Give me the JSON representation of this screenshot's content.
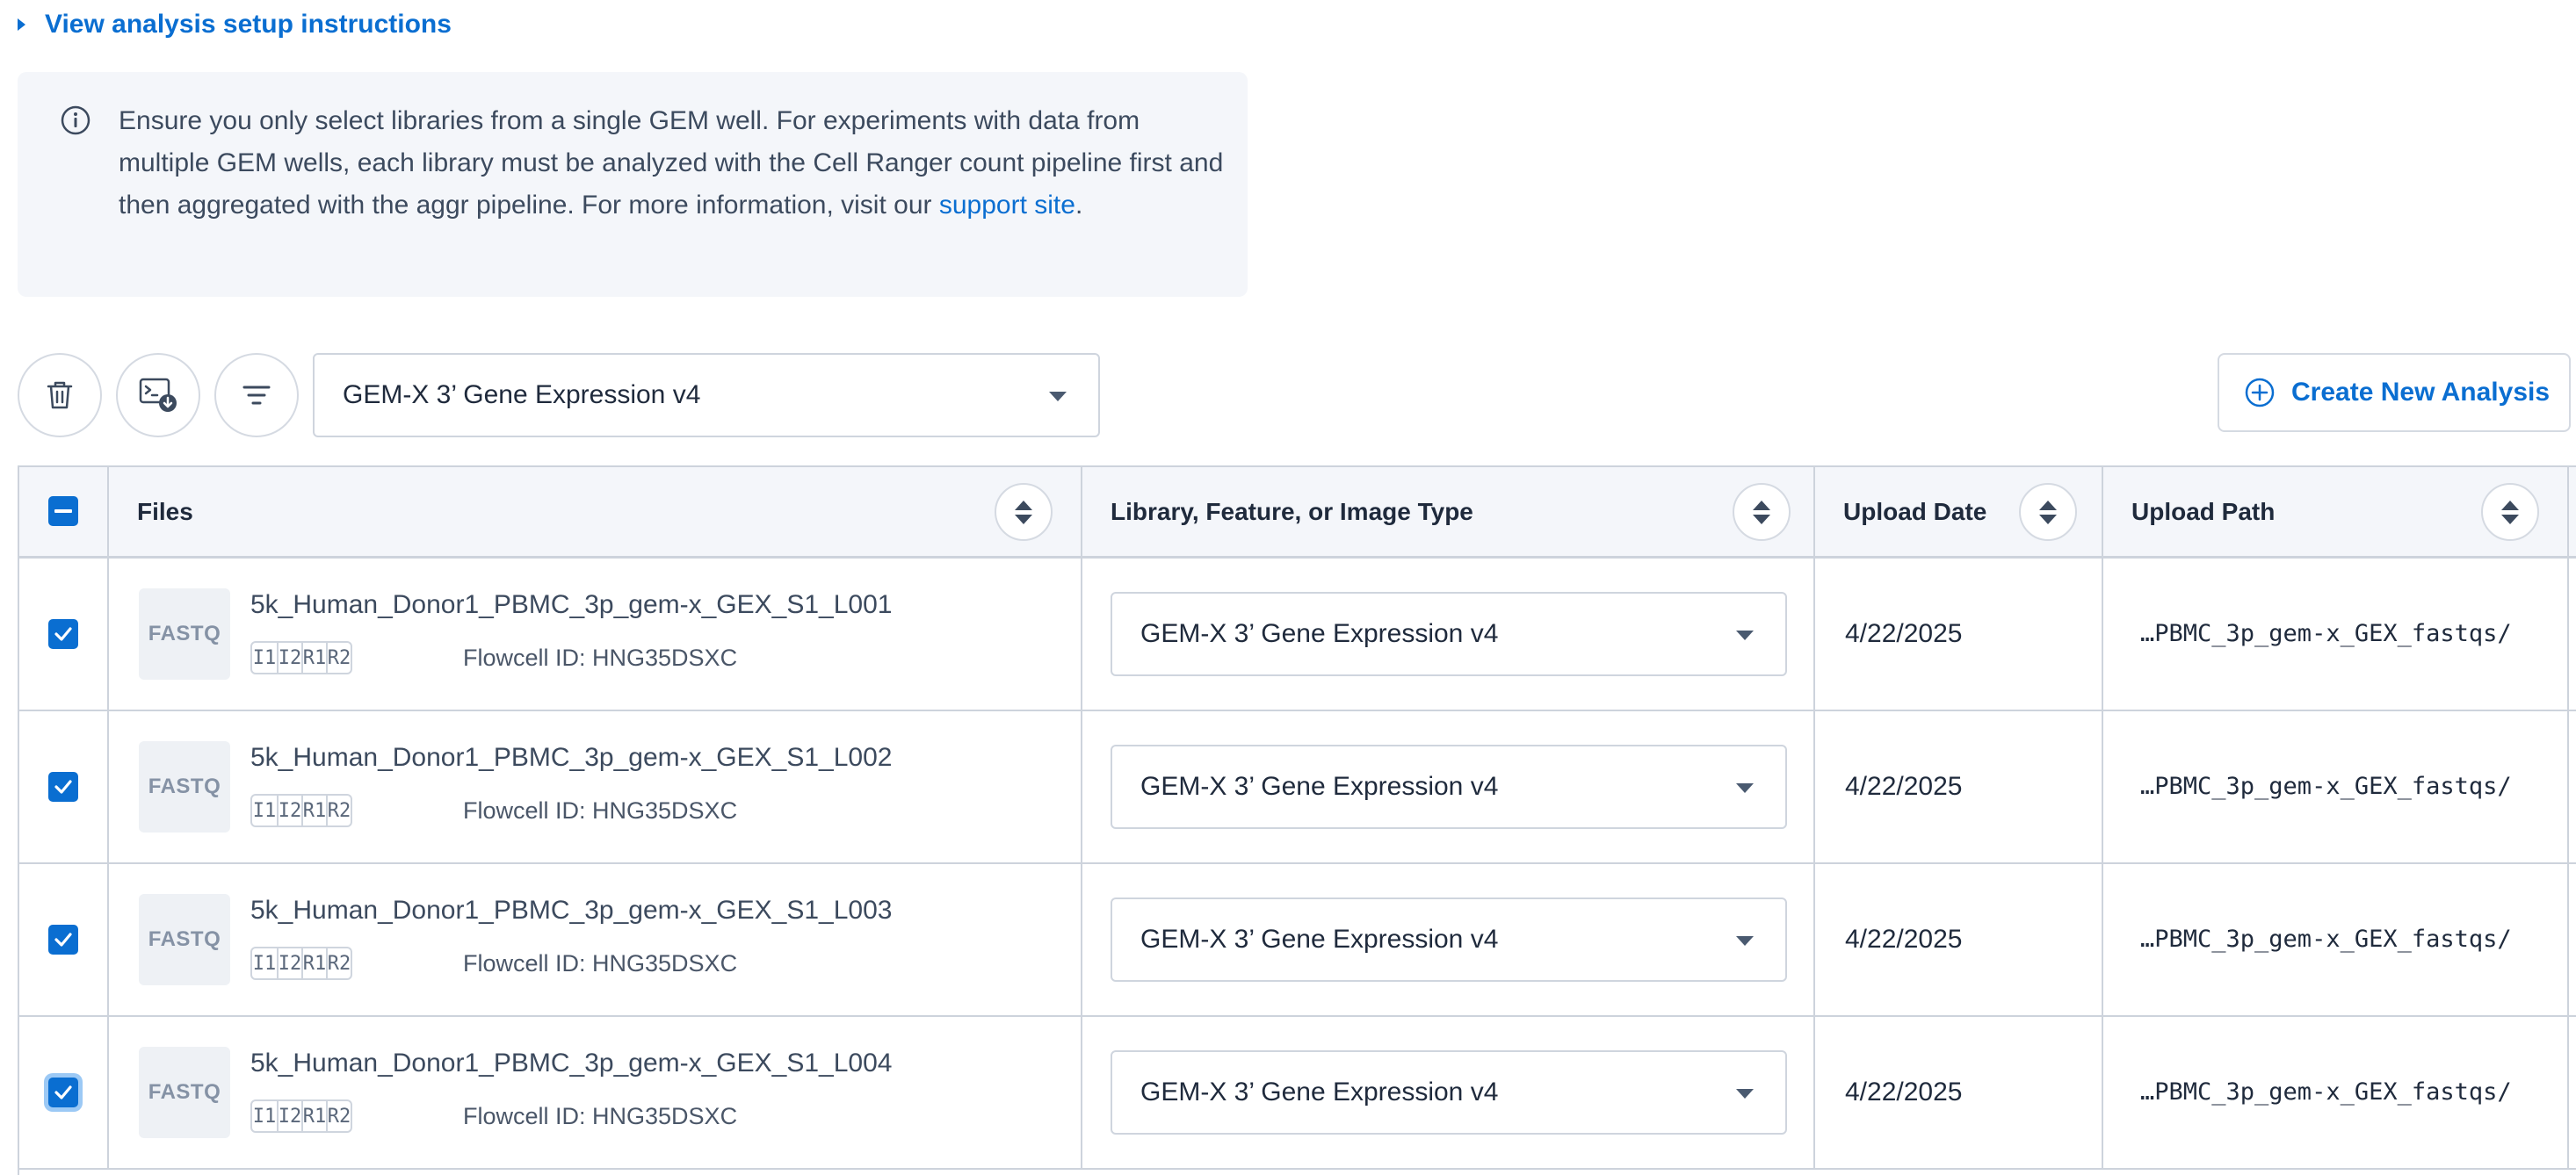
{
  "setup_link": {
    "label": "View analysis setup instructions"
  },
  "info": {
    "text": "Ensure you only select libraries from a single GEM well. For experiments with data from multiple GEM wells, each library must be analyzed with the Cell Ranger count pipeline first and then aggregated with the aggr pipeline. For more information, visit our ",
    "link": "support site",
    "end": "."
  },
  "toolbar": {
    "delete_icon": "trash-icon",
    "download_icon": "terminal-download-icon",
    "filter_icon": "filter-icon",
    "chemistry_select": {
      "value": "GEM-X 3’ Gene Expression v4"
    },
    "create_button": {
      "label": "Create New Analysis",
      "icon": "plus-circle-icon"
    }
  },
  "table": {
    "headers": {
      "files": "Files",
      "type": "Library, Feature, or Image Type",
      "date": "Upload Date",
      "path": "Upload Path"
    },
    "rows": [
      {
        "thumb": "FASTQ",
        "name": "5k_Human_Donor1_PBMC_3p_gem-x_GEX_S1_L001",
        "reads": [
          "I1",
          "I2",
          "R1",
          "R2"
        ],
        "flowcell": "Flowcell ID: HNG35DSXC",
        "type": "GEM-X 3’ Gene Expression v4",
        "date": "4/22/2025",
        "path": "…PBMC_3p_gem-x_GEX_fastqs/",
        "checked": true
      },
      {
        "thumb": "FASTQ",
        "name": "5k_Human_Donor1_PBMC_3p_gem-x_GEX_S1_L002",
        "reads": [
          "I1",
          "I2",
          "R1",
          "R2"
        ],
        "flowcell": "Flowcell ID: HNG35DSXC",
        "type": "GEM-X 3’ Gene Expression v4",
        "date": "4/22/2025",
        "path": "…PBMC_3p_gem-x_GEX_fastqs/",
        "checked": true
      },
      {
        "thumb": "FASTQ",
        "name": "5k_Human_Donor1_PBMC_3p_gem-x_GEX_S1_L003",
        "reads": [
          "I1",
          "I2",
          "R1",
          "R2"
        ],
        "flowcell": "Flowcell ID: HNG35DSXC",
        "type": "GEM-X 3’ Gene Expression v4",
        "date": "4/22/2025",
        "path": "…PBMC_3p_gem-x_GEX_fastqs/",
        "checked": true
      },
      {
        "thumb": "FASTQ",
        "name": "5k_Human_Donor1_PBMC_3p_gem-x_GEX_S1_L004",
        "reads": [
          "I1",
          "I2",
          "R1",
          "R2"
        ],
        "flowcell": "Flowcell ID: HNG35DSXC",
        "type": "GEM-X 3’ Gene Expression v4",
        "date": "4/22/2025",
        "path": "…PBMC_3p_gem-x_GEX_fastqs/",
        "checked": true
      }
    ]
  },
  "colors": {
    "accent": "#0a6ed1",
    "header_bg": "#f4f6fa",
    "border": "#cdd3dc"
  }
}
